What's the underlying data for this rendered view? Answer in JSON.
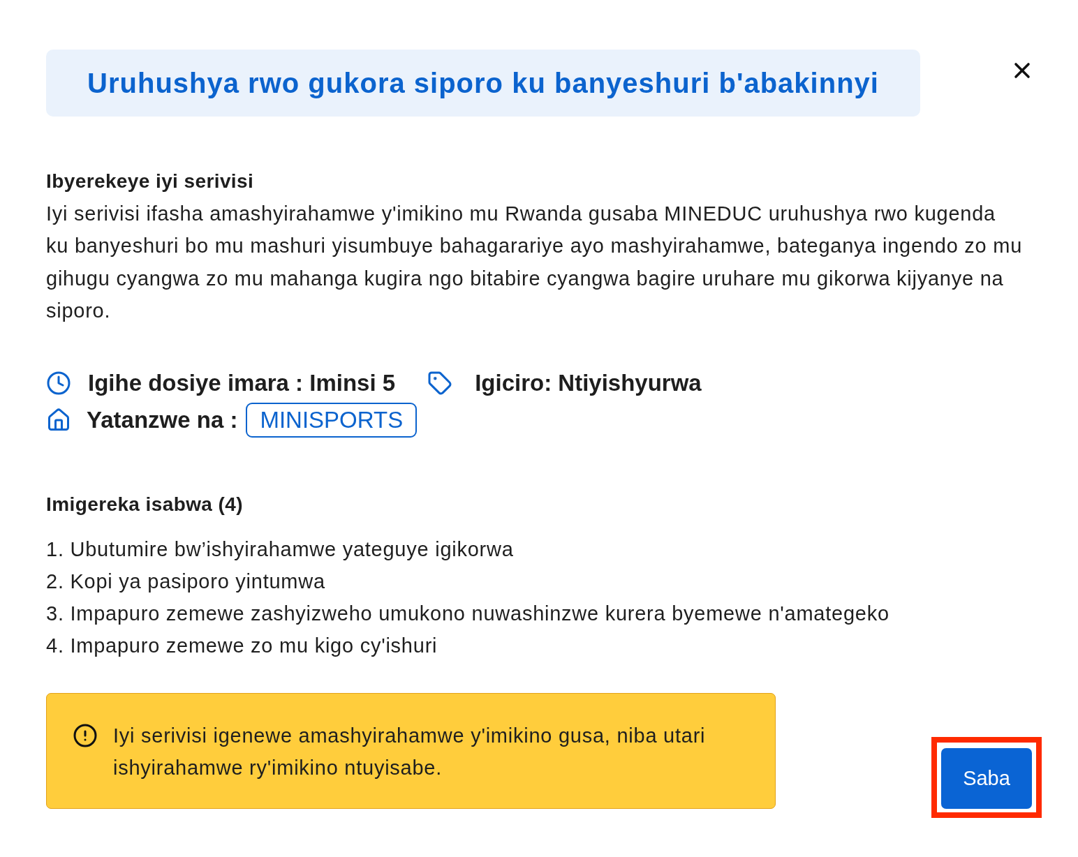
{
  "header": {
    "title": "Uruhushya rwo gukora siporo ku banyeshuri b'abakinnyi"
  },
  "about": {
    "heading": "Ibyerekeye iyi serivisi",
    "text": "Iyi serivisi ifasha amashyirahamwe y'imikino mu Rwanda gusaba MINEDUC uruhushya rwo kugenda ku banyeshuri bo mu mashuri yisumbuye bahagarariye ayo mashyirahamwe, bateganya ingendo zo mu gihugu cyangwa zo mu mahanga kugira ngo bitabire cyangwa bagire uruhare mu gikorwa kijyanye na siporo."
  },
  "details": [
    {
      "kind": "duration",
      "text": "Igihe dosiye imara : Iminsi 5"
    },
    {
      "kind": "price",
      "text": "Igiciro: Ntiyishyurwa"
    }
  ],
  "provider": {
    "label": "Yatanzwe na :",
    "name": "MINISPORTS"
  },
  "requirements": {
    "heading": "Imigereka isabwa (4)",
    "items": [
      "1. Ubutumire bw’ishyirahamwe yateguye igikorwa",
      "2. Kopi ya pasiporo yintumwa",
      "3. Impapuro zemewe zashyizweho umukono nuwashinzwe kurera byemewe n'amategeko",
      "4. Impapuro zemewe zo mu kigo cy'ishuri"
    ]
  },
  "notice": {
    "text": "Iyi serivisi igenewe amashyirahamwe y'imikino gusa, niba utari ishyirahamwe ry'imikino ntuyisabe."
  },
  "submit_button": {
    "label": "Saba",
    "highlighted": true
  }
}
